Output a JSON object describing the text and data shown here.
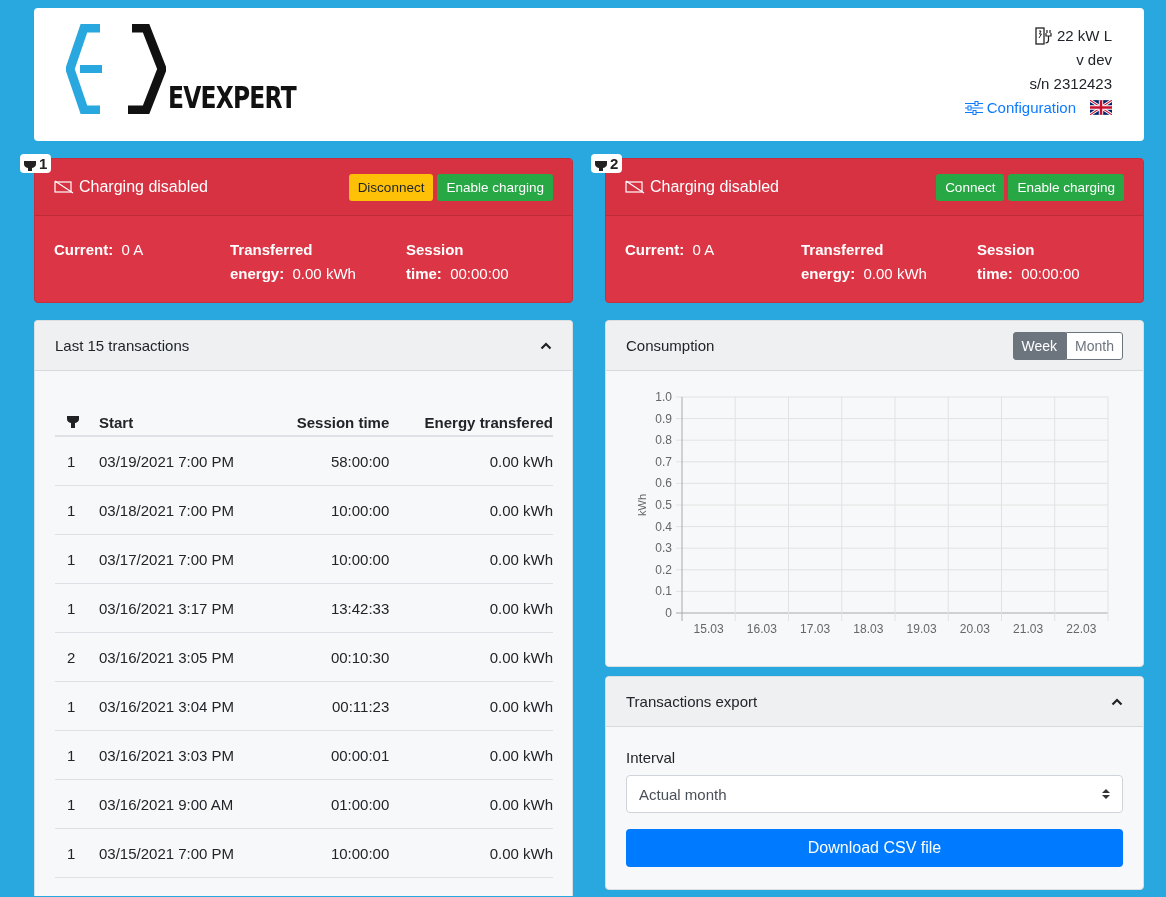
{
  "header": {
    "logo_text": "EVEXPERT",
    "power": "22 kW L",
    "version": "v dev",
    "serial": "s/n 2312423",
    "config_link": "Configuration"
  },
  "connectors": [
    {
      "number": "1",
      "status": "Charging disabled",
      "buttons": [
        {
          "label": "Disconnect",
          "kind": "warning"
        },
        {
          "label": "Enable charging",
          "kind": "success"
        }
      ],
      "stats": [
        {
          "label": "Current:",
          "value": "0 A"
        },
        {
          "label": "Transferred energy:",
          "value": "0.00 kWh"
        },
        {
          "label": "Session time:",
          "value": "00:00:00"
        }
      ]
    },
    {
      "number": "2",
      "status": "Charging disabled",
      "buttons": [
        {
          "label": "Connect",
          "kind": "success"
        },
        {
          "label": "Enable charging",
          "kind": "success"
        }
      ],
      "stats": [
        {
          "label": "Current:",
          "value": "0 A"
        },
        {
          "label": "Transferred energy:",
          "value": "0.00 kWh"
        },
        {
          "label": "Session time:",
          "value": "00:00:00"
        }
      ]
    }
  ],
  "transactions": {
    "title": "Last 15 transactions",
    "expanded": true,
    "columns": [
      "Start",
      "Session time",
      "Energy transfered"
    ],
    "rows": [
      {
        "connector": "1",
        "start": "03/19/2021 7:00 PM",
        "session_time": "58:00:00",
        "energy": "0.00 kWh"
      },
      {
        "connector": "1",
        "start": "03/18/2021 7:00 PM",
        "session_time": "10:00:00",
        "energy": "0.00 kWh"
      },
      {
        "connector": "1",
        "start": "03/17/2021 7:00 PM",
        "session_time": "10:00:00",
        "energy": "0.00 kWh"
      },
      {
        "connector": "1",
        "start": "03/16/2021 3:17 PM",
        "session_time": "13:42:33",
        "energy": "0.00 kWh"
      },
      {
        "connector": "2",
        "start": "03/16/2021 3:05 PM",
        "session_time": "00:10:30",
        "energy": "0.00 kWh"
      },
      {
        "connector": "1",
        "start": "03/16/2021 3:04 PM",
        "session_time": "00:11:23",
        "energy": "0.00 kWh"
      },
      {
        "connector": "1",
        "start": "03/16/2021 3:03 PM",
        "session_time": "00:00:01",
        "energy": "0.00 kWh"
      },
      {
        "connector": "1",
        "start": "03/16/2021 9:00 AM",
        "session_time": "01:00:00",
        "energy": "0.00 kWh"
      },
      {
        "connector": "1",
        "start": "03/15/2021 7:00 PM",
        "session_time": "10:00:00",
        "energy": "0.00 kWh"
      }
    ]
  },
  "consumption": {
    "title": "Consumption",
    "periods": [
      {
        "label": "Week",
        "selected": true
      },
      {
        "label": "Month",
        "selected": false
      }
    ],
    "chart_data": {
      "type": "bar",
      "grid": true,
      "ylabel": "kWh",
      "categories": [
        "15.03",
        "16.03",
        "17.03",
        "18.03",
        "19.03",
        "20.03",
        "21.03",
        "22.03"
      ],
      "values": [
        0,
        0,
        0,
        0,
        0,
        0,
        0,
        0
      ],
      "ylim": [
        0,
        1
      ],
      "yticks": [
        {
          "value": 0,
          "label": "0"
        },
        {
          "value": 0.1,
          "label": "0.1"
        },
        {
          "value": 0.2,
          "label": "0.2"
        },
        {
          "value": 0.3,
          "label": "0.3"
        },
        {
          "value": 0.4,
          "label": "0.4"
        },
        {
          "value": 0.5,
          "label": "0.5"
        },
        {
          "value": 0.6,
          "label": "0.6"
        },
        {
          "value": 0.7,
          "label": "0.7"
        },
        {
          "value": 0.8,
          "label": "0.8"
        },
        {
          "value": 0.9,
          "label": "0.9"
        },
        {
          "value": 1,
          "label": "1.0"
        }
      ]
    }
  },
  "export": {
    "title": "Transactions export",
    "expanded": true,
    "interval_label": "Interval",
    "interval_value": "Actual month",
    "download_button": "Download CSV file"
  }
}
